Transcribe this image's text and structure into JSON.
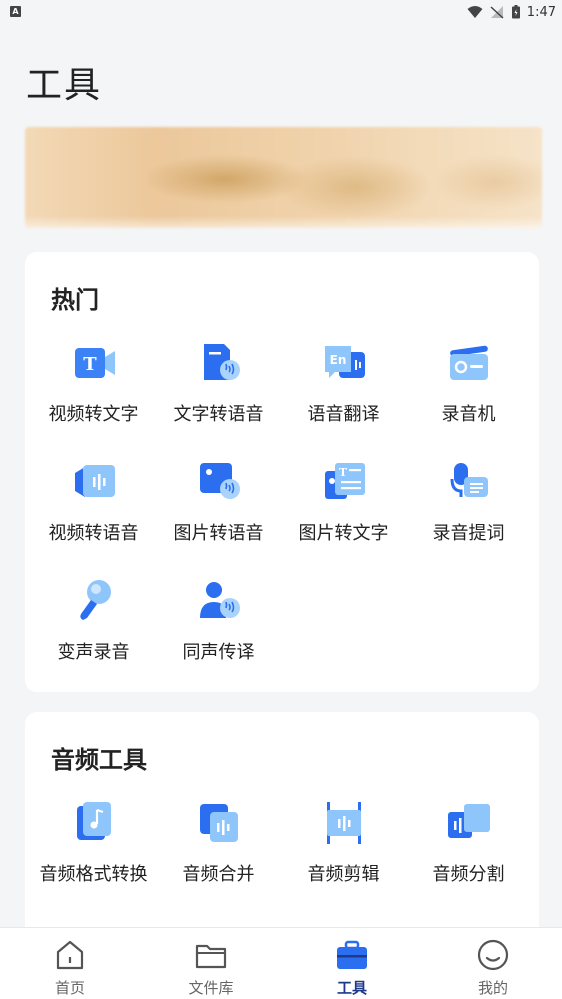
{
  "status_bar": {
    "time": "1:47",
    "badge": "A"
  },
  "page": {
    "title": "工具"
  },
  "hot": {
    "title": "热门",
    "items": [
      {
        "label": "视频转文字",
        "icon": "video-to-text-icon"
      },
      {
        "label": "文字转语音",
        "icon": "text-to-speech-icon"
      },
      {
        "label": "语音翻译",
        "icon": "voice-translate-icon"
      },
      {
        "label": "录音机",
        "icon": "recorder-icon"
      },
      {
        "label": "视频转语音",
        "icon": "video-to-audio-icon"
      },
      {
        "label": "图片转语音",
        "icon": "image-to-speech-icon"
      },
      {
        "label": "图片转文字",
        "icon": "image-to-text-icon"
      },
      {
        "label": "录音提词",
        "icon": "teleprompter-icon"
      },
      {
        "label": "变声录音",
        "icon": "voice-changer-icon"
      },
      {
        "label": "同声传译",
        "icon": "simultaneous-interpretation-icon"
      }
    ]
  },
  "audio_tools": {
    "title": "音频工具",
    "items": [
      {
        "label": "音频格式转换",
        "icon": "audio-format-convert-icon"
      },
      {
        "label": "音频合并",
        "icon": "audio-merge-icon"
      },
      {
        "label": "音频剪辑",
        "icon": "audio-cut-icon"
      },
      {
        "label": "音频分割",
        "icon": "audio-split-icon"
      }
    ]
  },
  "tabbar": {
    "active": "工具",
    "tabs": [
      {
        "label": "首页",
        "icon": "home-icon"
      },
      {
        "label": "文件库",
        "icon": "folder-icon"
      },
      {
        "label": "工具",
        "icon": "toolbox-icon"
      },
      {
        "label": "我的",
        "icon": "profile-icon"
      }
    ]
  },
  "colors": {
    "accent": "#2b6ff0",
    "accent_light": "#8fc2f7",
    "tab_active": "#1f3a8a"
  }
}
